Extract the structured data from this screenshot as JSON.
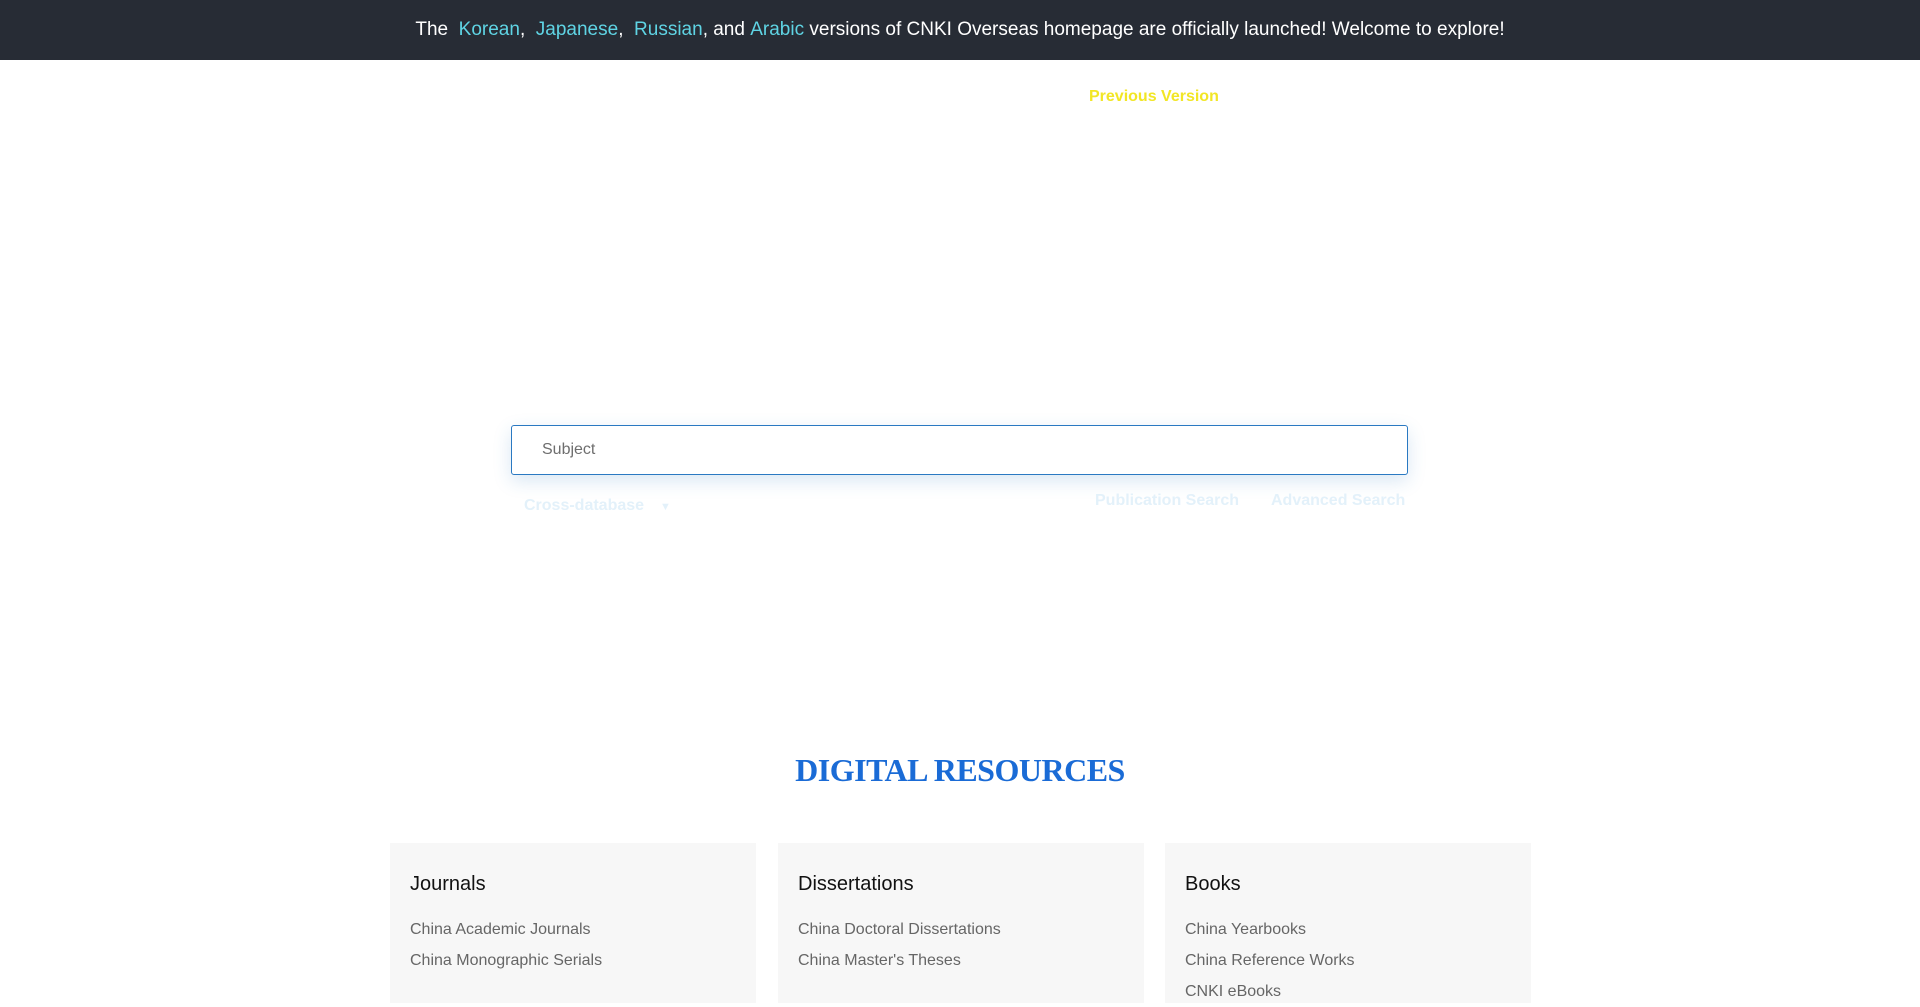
{
  "announcement": {
    "prefix": "The  ",
    "lang_korean": "Korean",
    "sep1": ",  ",
    "lang_japanese": "Japanese",
    "sep2": ",  ",
    "lang_russian": "Russian",
    "sep3": ", and ",
    "lang_arabic": "Arabic",
    "suffix": " versions of CNKI Overseas homepage are officially launched! Welcome to explore!"
  },
  "header": {
    "previous_version": "Previous Version"
  },
  "search": {
    "placeholder": "Subject",
    "cross_database": "Cross-database",
    "publication_search": "Publication Search",
    "advanced_search": "Advanced Search"
  },
  "digital_resources": {
    "title": "DIGITAL RESOURCES",
    "cards": [
      {
        "title": "Journals",
        "items": [
          "China Academic Journals",
          "China Monographic Serials"
        ]
      },
      {
        "title": "Dissertations",
        "items": [
          "China Doctoral Dissertations",
          "China Master's Theses"
        ]
      },
      {
        "title": "Books",
        "items": [
          "China Yearbooks",
          "China Reference Works",
          "CNKI eBooks"
        ]
      }
    ]
  },
  "colors": {
    "announcement_bg": "#272c35",
    "language_link": "#5fd4e4",
    "previous_version": "#f2e625",
    "search_border": "#2a79c2",
    "section_title": "#1a6bd6"
  }
}
